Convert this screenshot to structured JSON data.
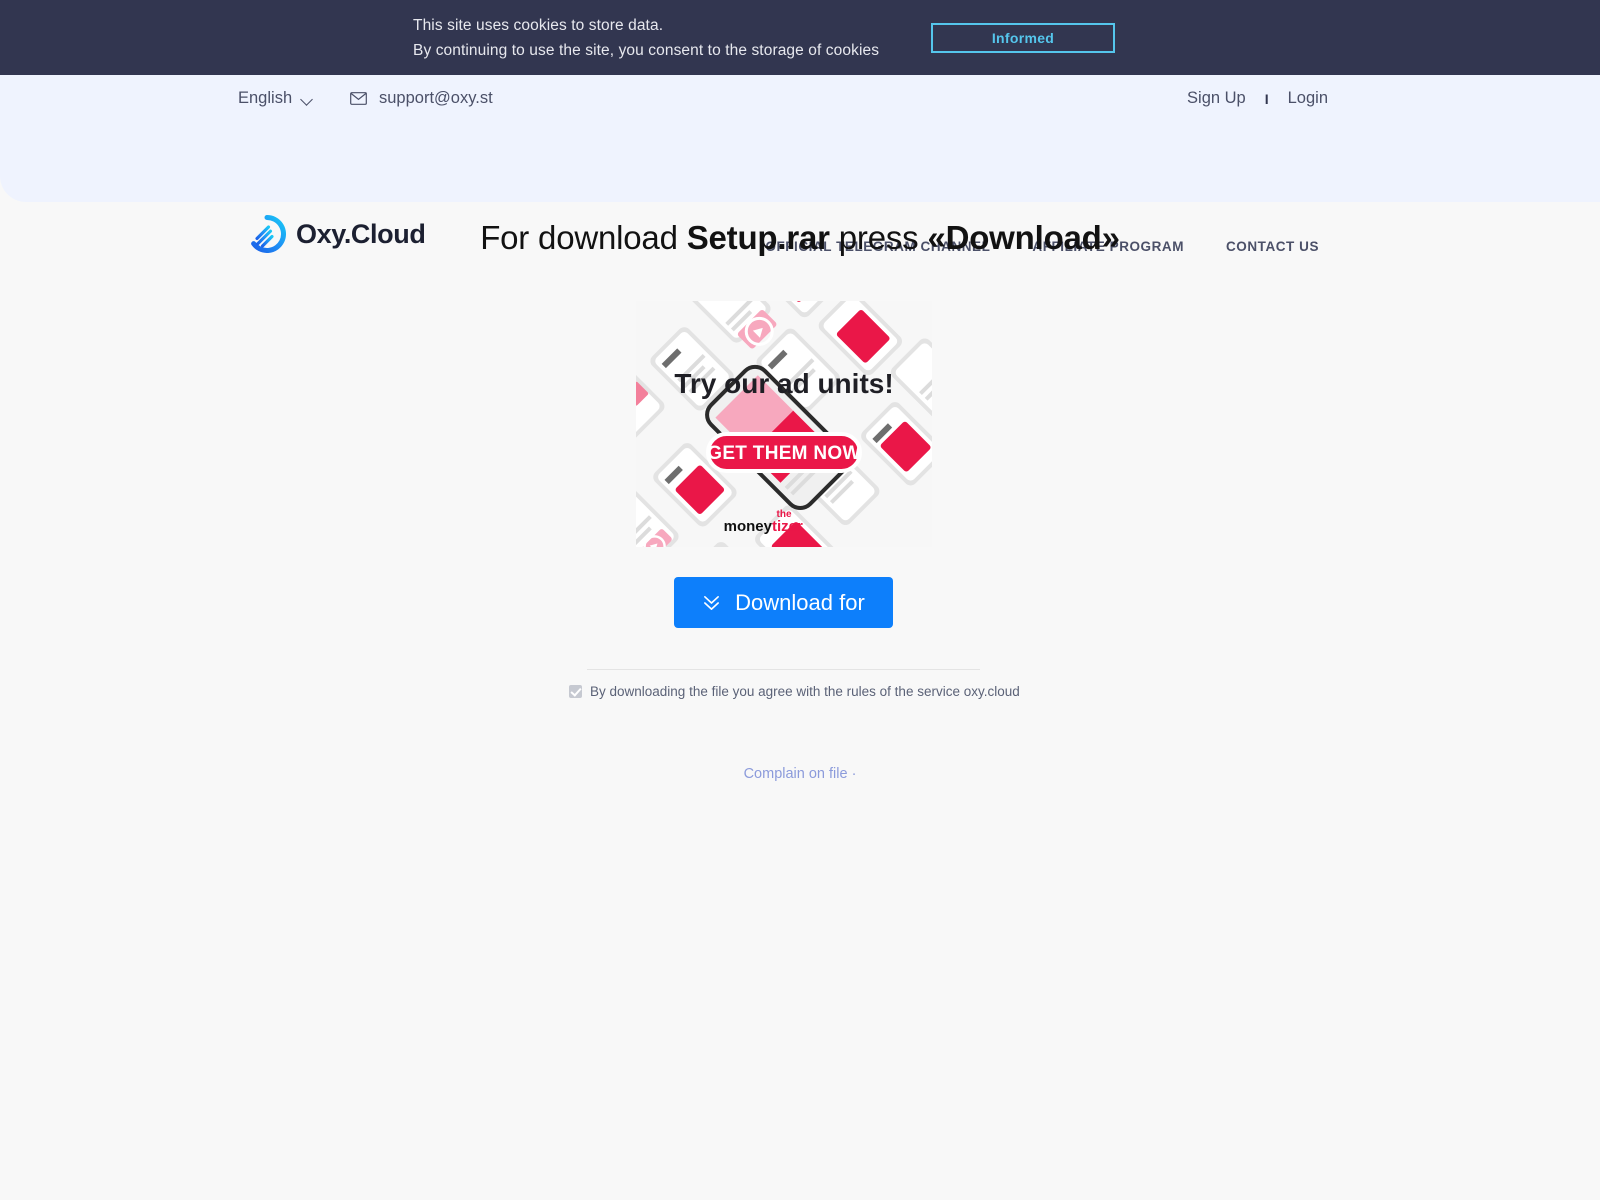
{
  "cookie_banner": {
    "line1": "This site uses cookies to store data.",
    "line2": "By continuing to use the site, you consent to the storage of cookies",
    "button_label": "Informed",
    "background": "#323650",
    "accent": "#55c6ec"
  },
  "header": {
    "language": "English",
    "language_icon": "chevron-down-icon",
    "email": "support@oxy.st",
    "email_icon": "envelope-icon",
    "sign_up": "Sign Up",
    "separator": "I",
    "login": "Login",
    "logo_text": "Oxy.Cloud",
    "logo_icon": "oxycloud-swirl-logo",
    "background": "#eff3fe",
    "nav": [
      {
        "label": "OFFICIAL TELEGRAM CHANNEL"
      },
      {
        "label": "AFFILIATE PROGRAM"
      },
      {
        "label": "CONTACT US"
      }
    ]
  },
  "main": {
    "headline_prefix": "For download ",
    "headline_filename": "Setup.rar",
    "headline_middle": " press ",
    "headline_action": "«Download»",
    "download_button": {
      "label": "Download for",
      "icon": "double-chevron-down-icon",
      "color": "#0d7ffb"
    },
    "agreement": {
      "checked": true,
      "text": "By downloading the file you agree with the rules of the service oxy.cloud"
    },
    "complain_link": "Complain on file ·"
  },
  "advertisement": {
    "headline": "Try our ad units!",
    "cta": "GET THEM NOW",
    "brand_the": "the",
    "brand_money": "money",
    "brand_tizer": "tizer",
    "accent": "#ea1748"
  }
}
